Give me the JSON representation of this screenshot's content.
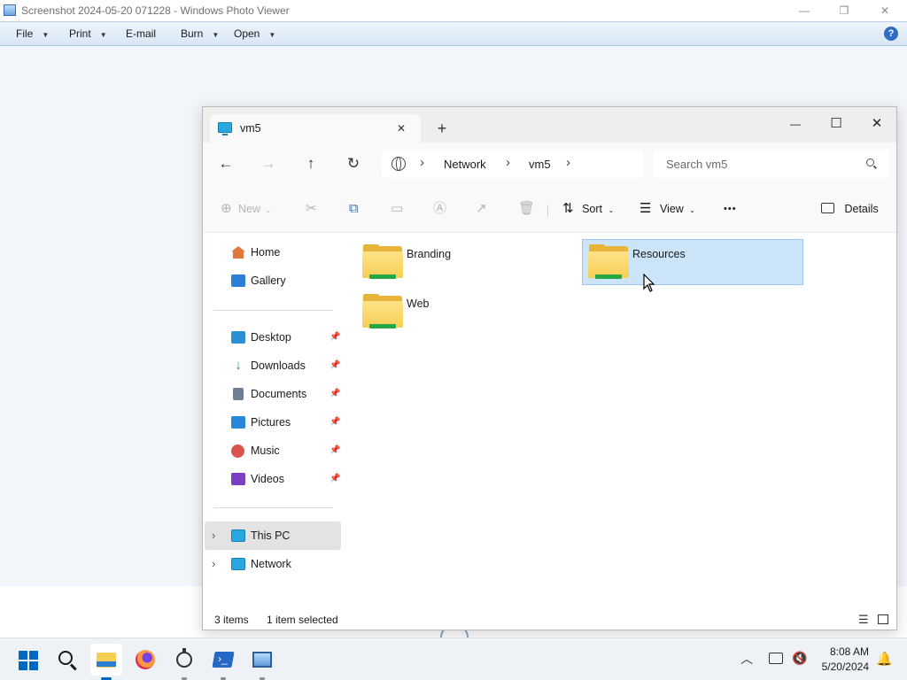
{
  "photo_viewer": {
    "title": "Screenshot 2024-05-20 071228 - Windows Photo Viewer",
    "window_buttons": {
      "minimize": "—",
      "maximize": "❐",
      "close": "✕"
    },
    "menu": [
      {
        "label": "File",
        "has_arrow": true
      },
      {
        "label": "Print",
        "has_arrow": true
      },
      {
        "label": "E-mail",
        "has_arrow": false
      },
      {
        "label": "Burn",
        "has_arrow": true
      },
      {
        "label": "Open",
        "has_arrow": true
      }
    ],
    "help_icon": "?"
  },
  "explorer": {
    "tab": {
      "title": "vm5",
      "close": "✕",
      "new_tab": "+"
    },
    "window_buttons": {
      "minimize": "—",
      "maximize": "☐",
      "close": "✕"
    },
    "nav": {
      "back": "←",
      "forward": "→",
      "up": "↑",
      "refresh": "↻"
    },
    "breadcrumb": [
      "Network",
      "vm5"
    ],
    "breadcrumb_sep": "›",
    "search_placeholder": "Search vm5",
    "commands": {
      "new": "New",
      "sort": "Sort",
      "view": "View",
      "more": "•••",
      "details": "Details"
    },
    "sidebar": {
      "quick": [
        {
          "label": "Home",
          "icon": "home-icon",
          "color": "#e07a3c"
        },
        {
          "label": "Gallery",
          "icon": "gallery-icon",
          "color": "#2c7fd6"
        }
      ],
      "pinned": [
        {
          "label": "Desktop",
          "icon": "desktop-icon",
          "color": "#2b8fd6"
        },
        {
          "label": "Downloads",
          "icon": "downloads-icon",
          "color": "#1e9e5a"
        },
        {
          "label": "Documents",
          "icon": "documents-icon",
          "color": "#6f7f93"
        },
        {
          "label": "Pictures",
          "icon": "pictures-icon",
          "color": "#2a86d8"
        },
        {
          "label": "Music",
          "icon": "music-icon",
          "color": "#d9534f"
        },
        {
          "label": "Videos",
          "icon": "videos-icon",
          "color": "#7b3fc4"
        }
      ],
      "locations": [
        {
          "label": "This PC",
          "icon": "this-pc-icon",
          "selected": true
        },
        {
          "label": "Network",
          "icon": "network-icon",
          "selected": false
        }
      ]
    },
    "files": [
      {
        "name": "Branding",
        "selected": false
      },
      {
        "name": "Resources",
        "selected": true
      },
      {
        "name": "Web",
        "selected": false
      }
    ],
    "status": {
      "count": "3 items",
      "selection": "1 item selected"
    }
  },
  "taskbar": {
    "apps": [
      "start-icon",
      "search-icon",
      "file-explorer-icon",
      "firefox-icon",
      "stopwatch-icon",
      "powershell-icon",
      "photo-viewer-icon"
    ],
    "clock_time": "8:08 AM",
    "clock_date": "5/20/2024",
    "accent": "#0067c0"
  }
}
